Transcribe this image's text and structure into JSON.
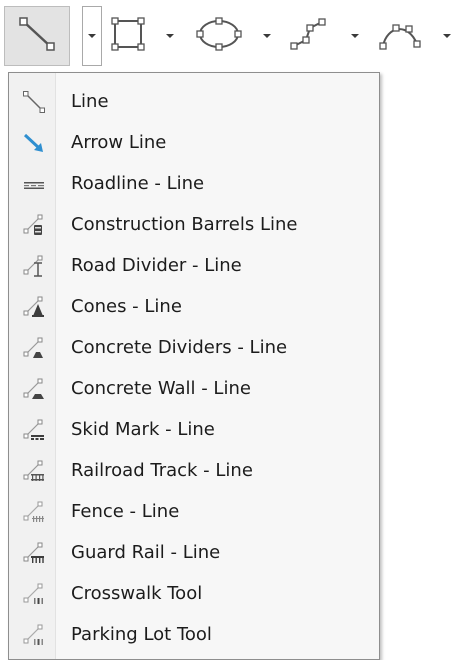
{
  "toolbar": {
    "tools": [
      {
        "name": "line-tool",
        "icon": "line-icon"
      },
      {
        "name": "rectangle-tool",
        "icon": "rectangle-icon"
      },
      {
        "name": "ellipse-tool",
        "icon": "ellipse-icon"
      },
      {
        "name": "polyline-tool",
        "icon": "polyline-icon"
      },
      {
        "name": "curve-tool",
        "icon": "curve-icon"
      }
    ]
  },
  "menu": {
    "items": [
      {
        "label": "Line",
        "icon": "line-icon"
      },
      {
        "label": "Arrow Line",
        "icon": "arrow-line-icon"
      },
      {
        "label": "Roadline - Line",
        "icon": "roadline-icon"
      },
      {
        "label": "Construction Barrels Line",
        "icon": "construction-barrels-icon"
      },
      {
        "label": "Road Divider - Line",
        "icon": "road-divider-icon"
      },
      {
        "label": "Cones - Line",
        "icon": "cones-icon"
      },
      {
        "label": "Concrete Dividers - Line",
        "icon": "concrete-dividers-icon"
      },
      {
        "label": "Concrete Wall - Line",
        "icon": "concrete-wall-icon"
      },
      {
        "label": "Skid Mark - Line",
        "icon": "skid-mark-icon"
      },
      {
        "label": "Railroad Track - Line",
        "icon": "railroad-track-icon"
      },
      {
        "label": "Fence - Line",
        "icon": "fence-icon"
      },
      {
        "label": "Guard Rail - Line",
        "icon": "guard-rail-icon"
      },
      {
        "label": "Crosswalk Tool",
        "icon": "crosswalk-icon"
      },
      {
        "label": "Parking Lot Tool",
        "icon": "parking-lot-icon"
      }
    ]
  },
  "colors": {
    "icon_stroke": "#555555",
    "handle_fill": "#ffffff",
    "arrow_blue": "#2f8fd0",
    "icon_dark": "#3d3d3d",
    "icon_muted": "#9a9a9a"
  }
}
